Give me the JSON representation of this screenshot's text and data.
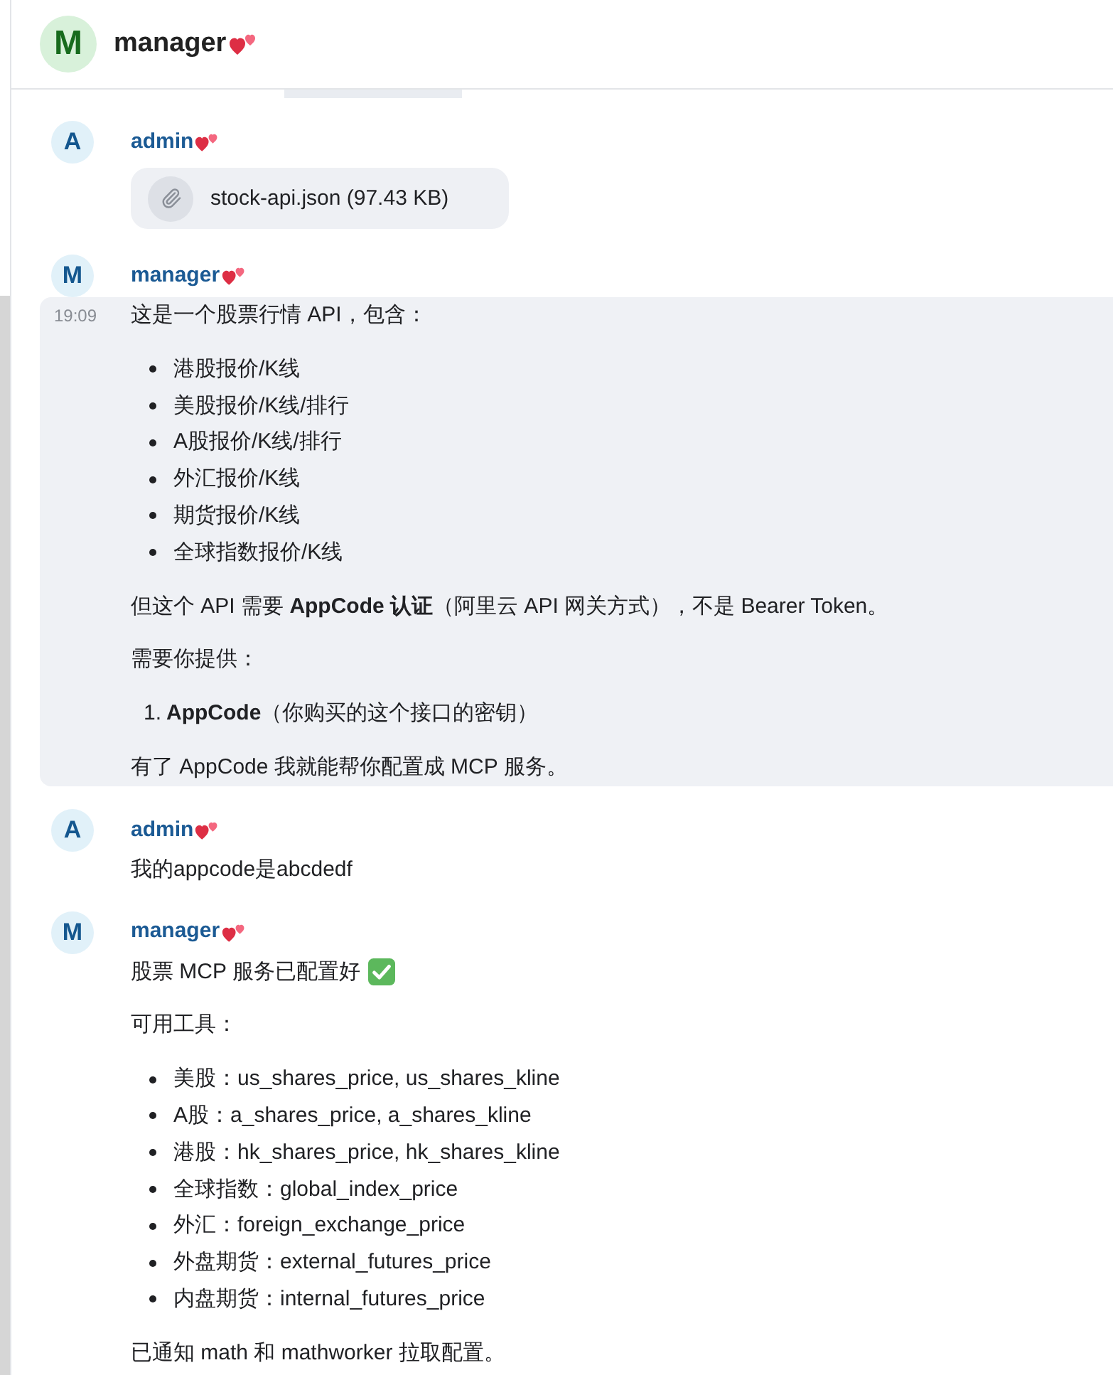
{
  "header": {
    "avatar_letter": "M",
    "name": "manager"
  },
  "messages": [
    {
      "avatar_letter": "A",
      "author": "admin",
      "highlighted": false,
      "blocks": [
        {
          "kind": "file",
          "text": "stock-api.json (97.43 KB)"
        }
      ]
    },
    {
      "avatar_letter": "M",
      "author": "manager",
      "highlighted": true,
      "time": "19:09",
      "blocks": [
        {
          "kind": "paragraph",
          "text": "这是一个股票行情 API，包含："
        },
        {
          "kind": "bullet_list",
          "items": [
            "港股报价/K线",
            "美股报价/K线/排行",
            "A股报价/K线/排行",
            "外汇报价/K线",
            "期货报价/K线",
            "全球指数报价/K线"
          ]
        },
        {
          "kind": "paragraph",
          "text": "但这个 API 需要 **AppCode 认证**（阿里云 API 网关方式），不是 Bearer Token。"
        },
        {
          "kind": "paragraph",
          "text": "需要你提供："
        },
        {
          "kind": "numbered_list",
          "items": [
            {
              "number": "1.",
              "text": "**AppCode**（你购买的这个接口的密钥）"
            }
          ]
        },
        {
          "kind": "paragraph",
          "text": "有了 AppCode 我就能帮你配置成 MCP 服务。"
        }
      ]
    },
    {
      "avatar_letter": "A",
      "author": "admin",
      "highlighted": false,
      "blocks": [
        {
          "kind": "paragraph",
          "text": "我的appcode是abcdedf"
        }
      ]
    },
    {
      "avatar_letter": "M",
      "author": "manager",
      "highlighted": false,
      "blocks": [
        {
          "kind": "paragraph",
          "text": "股票 MCP 服务已配置好",
          "check": true
        },
        {
          "kind": "paragraph",
          "text": "可用工具："
        },
        {
          "kind": "bullet_list",
          "items": [
            "美股：us_shares_price, us_shares_kline",
            "A股：a_shares_price, a_shares_kline",
            "港股：hk_shares_price, hk_shares_kline",
            "全球指数：global_index_price",
            "外汇：foreign_exchange_price",
            "外盘期货：external_futures_price",
            "内盘期货：internal_futures_price"
          ]
        },
        {
          "kind": "paragraph",
          "text": "已通知 math 和 mathworker 拉取配置。"
        }
      ]
    }
  ]
}
